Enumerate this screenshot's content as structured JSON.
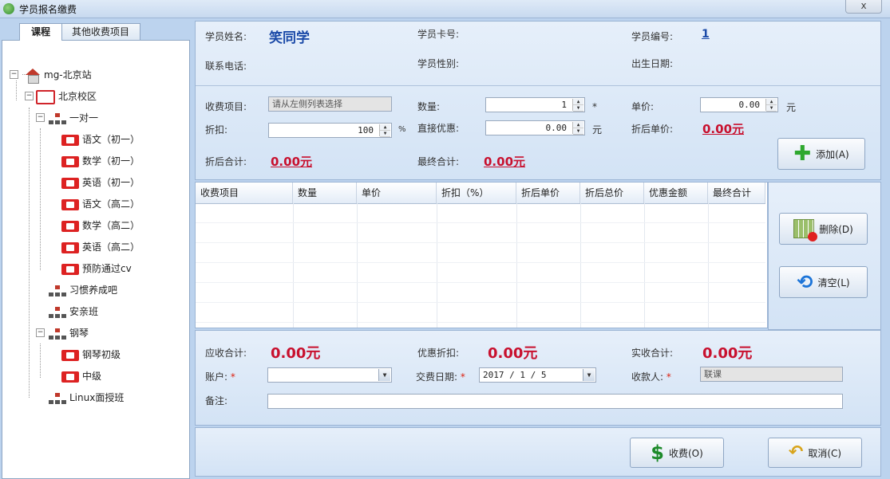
{
  "window": {
    "title": "学员报名缴费",
    "close_label": "x"
  },
  "tabs": [
    {
      "label": "课程"
    },
    {
      "label": "其他收费项目"
    }
  ],
  "tree": {
    "root": "mg-北京站",
    "campus": "北京校区",
    "groups": [
      {
        "label": "一对一",
        "items": [
          "语文（初一）",
          "数学（初一）",
          "英语（初一）",
          "语文（高二）",
          "数学（高二）",
          "英语（高二）",
          "预防通过cv"
        ]
      },
      {
        "label": "习惯养成吧",
        "items": []
      },
      {
        "label": "安亲班",
        "items": []
      },
      {
        "label": "钢琴",
        "items": [
          "钢琴初级",
          "中级"
        ]
      },
      {
        "label": "Linux面授班",
        "items": []
      }
    ]
  },
  "student": {
    "name_label": "学员姓名:",
    "name": "笑同学",
    "card_label": "学员卡号:",
    "card": "",
    "id_label": "学员编号:",
    "id": "1",
    "phone_label": "联系电话:",
    "gender_label": "学员性别:",
    "birth_label": "出生日期:"
  },
  "fee": {
    "item_label": "收费项目:",
    "item_placeholder": "请从左侧列表选择",
    "qty_label": "数量:",
    "qty": "1",
    "qty_required": "*",
    "price_label": "单价:",
    "price": "0.00",
    "price_unit": "元",
    "discount_label": "折扣:",
    "discount": "100",
    "discount_unit": "%",
    "direct_label": "直接优惠:",
    "direct": "0.00",
    "direct_unit": "元",
    "disc_price_label": "折后单价:",
    "disc_price": "0.00元",
    "disc_total_label": "折后合计:",
    "disc_total": "0.00元",
    "final_label": "最终合计:",
    "final": "0.00元",
    "add_button": "添加(A)"
  },
  "table": {
    "columns": [
      "收费项目",
      "数量",
      "单价",
      "折扣（%）",
      "折后单价",
      "折后总价",
      "优惠金额",
      "最终合计"
    ]
  },
  "side_buttons": {
    "delete": "删除(D)",
    "clear": "清空(L)"
  },
  "summary": {
    "due_label": "应收合计:",
    "due": "0.00元",
    "discount_label": "优惠折扣:",
    "discount": "0.00元",
    "actual_label": "实收合计:",
    "actual": "0.00元",
    "account_label": "账户:",
    "required": "*",
    "date_label": "交费日期:",
    "date": "2017 / 1 / 5",
    "payee_label": "收款人:",
    "payee": "联课",
    "remark_label": "备注:"
  },
  "actions": {
    "charge": "收费(O)",
    "cancel": "取消(C)"
  },
  "colors": {
    "accent_blue": "#1b4aa8",
    "money_red": "#c8102e"
  }
}
